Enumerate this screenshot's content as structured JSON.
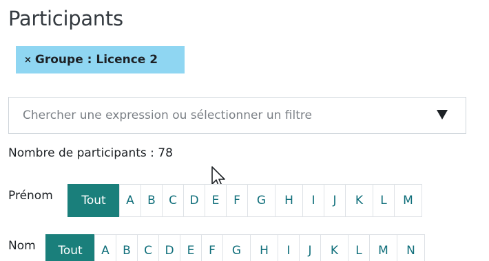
{
  "page": {
    "title": "Participants"
  },
  "filter_chip": {
    "remove_icon": "×",
    "label": "Groupe : Licence 2"
  },
  "search": {
    "placeholder": "Chercher une expression ou sélectionner un filtre",
    "dropdown_icon": "caret-down-icon"
  },
  "participants": {
    "count_text": "Nombre de participants : 78"
  },
  "first_name_filter": {
    "label": "Prénom",
    "all_label": "Tout",
    "letters": [
      "A",
      "B",
      "C",
      "D",
      "E",
      "F",
      "G",
      "H",
      "I",
      "J",
      "K",
      "L",
      "M"
    ]
  },
  "last_name_filter": {
    "label": "Nom",
    "all_label": "Tout",
    "letters": [
      "A",
      "B",
      "C",
      "D",
      "E",
      "F",
      "G",
      "H",
      "I",
      "J",
      "K",
      "L",
      "M",
      "N"
    ]
  },
  "colors": {
    "chip_bg": "#8fd6f2",
    "active_letter_bg": "#1a7f7b",
    "letter_text": "#0f6e7a"
  }
}
